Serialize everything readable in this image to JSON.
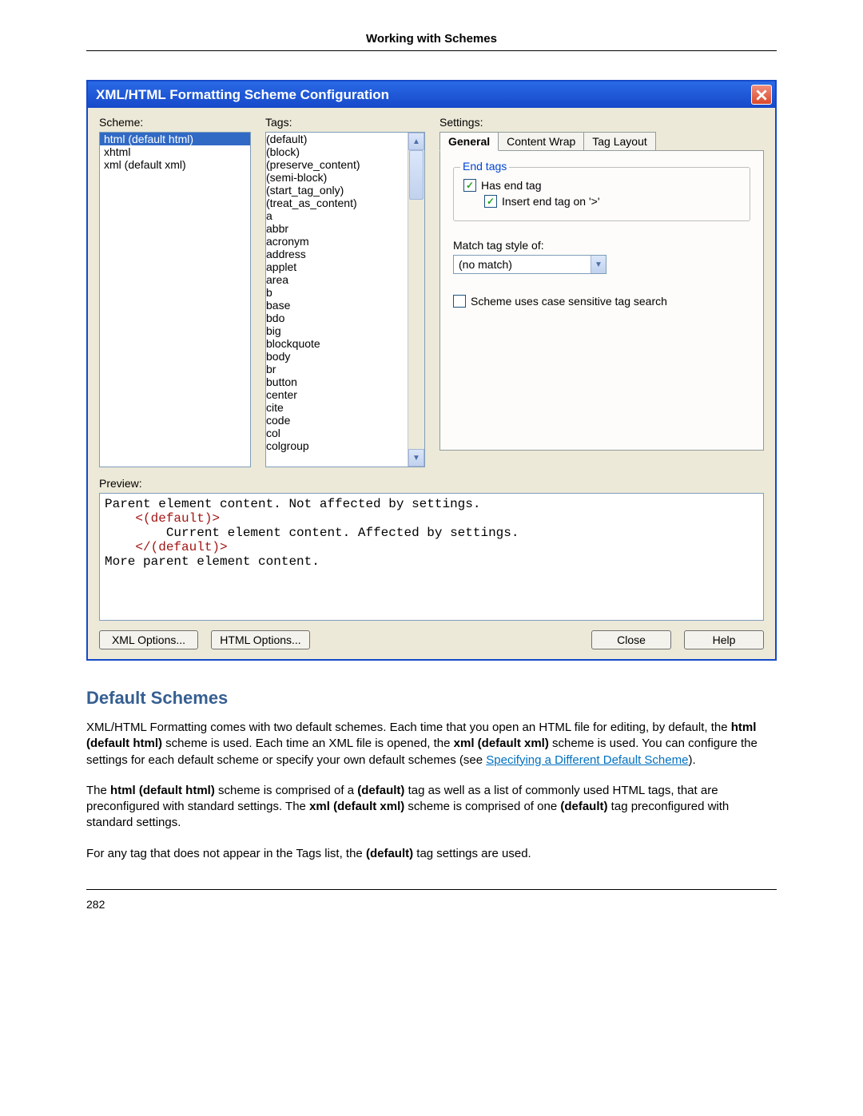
{
  "doc": {
    "header": "Working with Schemes",
    "section_heading": "Default Schemes",
    "para1_pre": "XML/HTML Formatting comes with two default schemes. Each time that you open an HTML file for editing, by default, the ",
    "para1_b1": "html (default html)",
    "para1_mid1": " scheme is used. Each time an XML file is opened, the ",
    "para1_b2": "xml (default xml)",
    "para1_mid2": " scheme is used. You can configure the settings for each default scheme or specify your own default schemes (see ",
    "para1_link": "Specifying a Different Default Scheme",
    "para1_end": ").",
    "para2_a": "The ",
    "para2_b1": "html (default html)",
    "para2_b": " scheme is comprised of a ",
    "para2_b2": "(default)",
    "para2_c": " tag as well as a list of commonly used HTML tags, that are preconfigured with standard settings. The ",
    "para2_b3": "xml (default xml)",
    "para2_d": " scheme is comprised of one ",
    "para2_b4": "(default)",
    "para2_e": " tag preconfigured with standard settings.",
    "para3_a": "For any tag that does not appear in the Tags list, the ",
    "para3_b": "(default)",
    "para3_c": " tag settings are used.",
    "page_number": "282"
  },
  "dialog": {
    "title": "XML/HTML Formatting Scheme Configuration",
    "labels": {
      "scheme": "Scheme:",
      "tags": "Tags:",
      "settings": "Settings:",
      "preview": "Preview:",
      "match_tag": "Match tag style of:"
    },
    "scheme_list": {
      "selected": "html (default html)",
      "items": [
        "xhtml",
        "xml (default xml)"
      ]
    },
    "tags_list": {
      "selected": "(default)",
      "items": [
        "(block)",
        "(preserve_content)",
        "(semi-block)",
        "(start_tag_only)",
        "(treat_as_content)",
        "a",
        "abbr",
        "acronym",
        "address",
        "applet",
        "area",
        "b",
        "base",
        "bdo",
        "big",
        "blockquote",
        "body",
        "br",
        "button",
        "center",
        "cite",
        "code",
        "col",
        "colgroup"
      ]
    },
    "tabs": {
      "general": "General",
      "content_wrap": "Content Wrap",
      "tag_layout": "Tag Layout"
    },
    "fieldset_legend": "End tags",
    "cb_has_end": "Has end tag",
    "cb_insert_end": "Insert end tag on '>'",
    "combo_value": "(no match)",
    "cb_case_sensitive": "Scheme uses case sensitive tag search",
    "preview_lines": {
      "l1": "Parent element content. Not affected by settings.",
      "l2_indent": "    ",
      "l2_tag": "<(default)>",
      "l3_indent": "        ",
      "l3": "Current element content. Affected by settings.",
      "l4_indent": "    ",
      "l4_tag": "</(default)>",
      "l5": "More parent element content."
    },
    "buttons": {
      "xml_options": "XML Options...",
      "html_options": "HTML Options...",
      "close": "Close",
      "help": "Help"
    }
  }
}
